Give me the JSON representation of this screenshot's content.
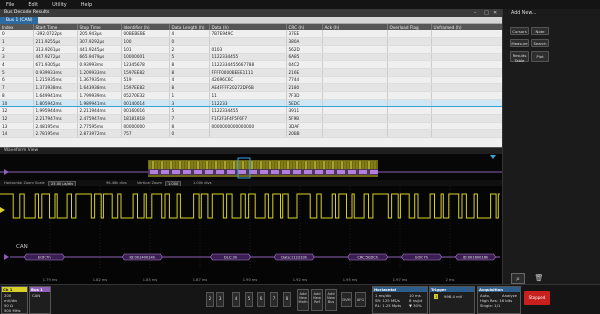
{
  "menu": [
    "File",
    "Edit",
    "Utility",
    "Help"
  ],
  "results": {
    "title": "Bus Decode Results",
    "tab": "Bus 1 (CAN)",
    "columns": [
      "Index",
      "Start Time",
      "Stop Time",
      "Identifier (h)",
      "Data Length (h)",
      "Data (h)",
      "CRC (h)",
      "Ack (h)",
      "Overload Flag",
      "Unframed (h)"
    ],
    "rows": [
      [
        "0",
        "-392.0722ps",
        "205.943μs",
        "00BEBEBE",
        "4",
        "7B7E949C",
        "37EE",
        "",
        "",
        ""
      ],
      [
        "1",
        "211.9255μs",
        "307.9292μs",
        "100",
        "0",
        "",
        "380A",
        "",
        "",
        ""
      ],
      [
        "2",
        "313.9261μs",
        "441.9245μs",
        "101",
        "2",
        "0103",
        "562D",
        "",
        "",
        ""
      ],
      [
        "3",
        "447.9272μs",
        "665.9479μs",
        "10000001",
        "5",
        "1122334455",
        "6A85",
        "",
        "",
        ""
      ],
      [
        "4",
        "671.9305μs",
        "0.93993ms",
        "12345678",
        "8",
        "1122334455667788",
        "04C2",
        "",
        "",
        ""
      ],
      [
        "5",
        "0.939933ms",
        "1.209933ms",
        "1597EE82",
        "8",
        "FFFF0000BEEE1111",
        "216E",
        "",
        "",
        ""
      ],
      [
        "6",
        "1.215935ms",
        "1.367935ms",
        "519",
        "4",
        "42696C6C",
        "7744",
        "",
        "",
        ""
      ],
      [
        "7",
        "1.373938ms",
        "1.643938ms",
        "1597EE82",
        "8",
        "AE4FFFF20272DF6B",
        "2180",
        "",
        "",
        ""
      ],
      [
        "8",
        "1.649941ms",
        "1.799939ms",
        "05270E32",
        "1",
        "11",
        "7F3D",
        "",
        "",
        ""
      ],
      [
        "10",
        "1.805942ms",
        "1.989941ms",
        "00140014",
        "3",
        "112233",
        "5EDC",
        "",
        "",
        ""
      ],
      [
        "12",
        "1.995944ms",
        "2.211944ms",
        "00160016",
        "5",
        "1122334455",
        "3911",
        "",
        "",
        ""
      ],
      [
        "12",
        "2.217947ms",
        "2.475947ms",
        "18181818",
        "7",
        "F1F2F3F4F5F6F7",
        "5F9B",
        "",
        "",
        ""
      ],
      [
        "13",
        "2.48195ms",
        "2.77595ms",
        "00000000",
        "8",
        "0000000000000000",
        "3DAF",
        "",
        "",
        ""
      ],
      [
        "14",
        "2.78195ms",
        "2.873972ms",
        "757",
        "0",
        "",
        "20BB",
        "",
        "",
        ""
      ]
    ],
    "selected_row": 9
  },
  "right_panel": {
    "add_new": "Add New...",
    "cursors": "Cursors",
    "note": "Note",
    "measure": "Measure",
    "search": "Search",
    "results_table": "Results Table",
    "plot": "Plot"
  },
  "waveform": {
    "title": "Waveform View",
    "zoom_label": "Horizontal Zoom Scale",
    "zoom_value": "25.00 μs/div",
    "zoom_pct": "96.46k divs",
    "vzoom_label": "Vertical Zoom",
    "vzoom_value": "1.000",
    "vzoom_pct": "1.00k divs",
    "bus_label": "CAN",
    "decode_labels": [
      {
        "text": "EOF:7h",
        "pos": 0.07
      },
      {
        "text": "ID:00140014h",
        "pos": 0.27
      },
      {
        "text": "DLC:3h",
        "pos": 0.45
      },
      {
        "text": "Data:112233h",
        "pos": 0.58
      },
      {
        "text": "CRC:5EDCh",
        "pos": 0.73
      },
      {
        "text": "EOF:7h",
        "pos": 0.84
      },
      {
        "text": "ID:00160016h",
        "pos": 0.95
      }
    ],
    "time_ticks": [
      "1.79 ms",
      "1.82 ms",
      "1.85 ms",
      "1.87 ms",
      "1.90 ms",
      "1.92 ms",
      "1.95 ms",
      "1.97 ms",
      "2 ms"
    ]
  },
  "bottom": {
    "ch1": {
      "label": "Ch 1",
      "l1": "200 mV/div",
      "l2": "50 Ω",
      "l3": "500 MHz"
    },
    "bus1": {
      "label": "Bus 1",
      "l1": "CAN"
    },
    "channels": [
      "2",
      "3",
      "4",
      "5",
      "6",
      "7",
      "8"
    ],
    "add_math": "Add New Math",
    "add_ref": "Add New Ref",
    "add_bus": "Add New Bus",
    "dvm": "DVM",
    "afg": "AFG",
    "horizontal": {
      "label": "Horizontal",
      "l1": "1 ms/div",
      "l2": "SR: 125 MS/s",
      "l3": "RL: 1.25 Mpts",
      "r1": "10 ms",
      "r2": "8 ns/pt",
      "r3": "▼ 30%"
    },
    "trigger": {
      "label": "Trigger",
      "l1": "1",
      "l2": "998.4 mV"
    },
    "acquisition": {
      "label": "Acquisition",
      "l1": "Auto,",
      "l2": "High Res: 16 bits",
      "l3": "Single: 1/1",
      "r1": "Analyze"
    },
    "run": "Stopped"
  },
  "colors": {
    "ch1": "#d7d028",
    "bus": "#8f5fb8",
    "run": "#c81f1f"
  }
}
